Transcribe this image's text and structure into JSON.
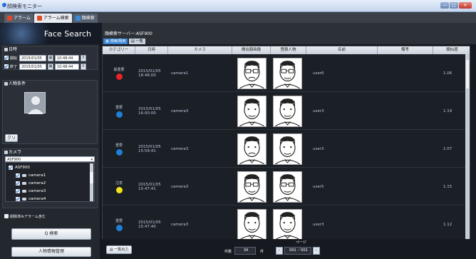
{
  "window": {
    "title": "顔検索モニター",
    "min": "—",
    "max": "□",
    "close": "✕"
  },
  "tabs": [
    {
      "label": "アラーム",
      "icon": "alarm-icon",
      "color": "#e04a2a"
    },
    {
      "label": "アラーム検索",
      "icon": "search-icon",
      "color": "#e04a2a",
      "active": true
    },
    {
      "label": "顔検索",
      "icon": "face-icon",
      "color": "#3a8ad8"
    }
  ],
  "banner": {
    "title": "Face Search"
  },
  "date": {
    "header": "日時",
    "start": {
      "label": "開始",
      "date": "2015/01/05",
      "time": "10:48:44"
    },
    "end": {
      "label": "終了",
      "date": "2015/01/05",
      "time": "10:48:44"
    }
  },
  "person": {
    "header": "人物条件",
    "clear": "クリア"
  },
  "camera": {
    "header": "カメラ",
    "server": "ASF900",
    "root": "ASF900",
    "items": [
      "camera1",
      "camera2",
      "camera3",
      "camera4"
    ]
  },
  "deleted_alarm": "削除済みアラーム含む",
  "search_button": "Q 検索",
  "manage_button": "人物情報管理",
  "right": {
    "server_label": "顔検索サーバー:ASF900",
    "view_tab1": "検索/隔用",
    "view_tab2": "一覧"
  },
  "table": {
    "headers": [
      "カテゴリー",
      "日時",
      "カメラ",
      "検出顔画像",
      "登録人物",
      "名前",
      "備考",
      "類似度"
    ],
    "rows": [
      {
        "sev_label": "最重要",
        "sev_color": "#e8232a",
        "date": "2015/01/05",
        "time": "18:48:00",
        "camera": "camera1",
        "name": "user6",
        "score": "1.06"
      },
      {
        "sev_label": "重要",
        "sev_color": "#1f7fd6",
        "date": "2015/01/05",
        "time": "16:00:00",
        "camera": "camera3",
        "name": "user3",
        "score": "1.19"
      },
      {
        "sev_label": "重要",
        "sev_color": "#1f7fd6",
        "date": "2015/01/05",
        "time": "15:59:41",
        "camera": "camera3",
        "name": "user3",
        "score": "1.07"
      },
      {
        "sev_label": "注意",
        "sev_color": "#f2e51a",
        "date": "2015/01/05",
        "time": "15:47:41",
        "camera": "camera3",
        "name": "user5",
        "score": "1.15"
      },
      {
        "sev_label": "重要",
        "sev_color": "#1f7fd6",
        "date": "2015/01/05",
        "time": "15:47:40",
        "camera": "camera3",
        "name": "user3",
        "score": "1.12"
      }
    ]
  },
  "footer": {
    "export": "一覧出力",
    "count_label": "件数",
    "count": "34",
    "count_unit": "件",
    "page_label": "ページ",
    "page": "001 ／001"
  }
}
